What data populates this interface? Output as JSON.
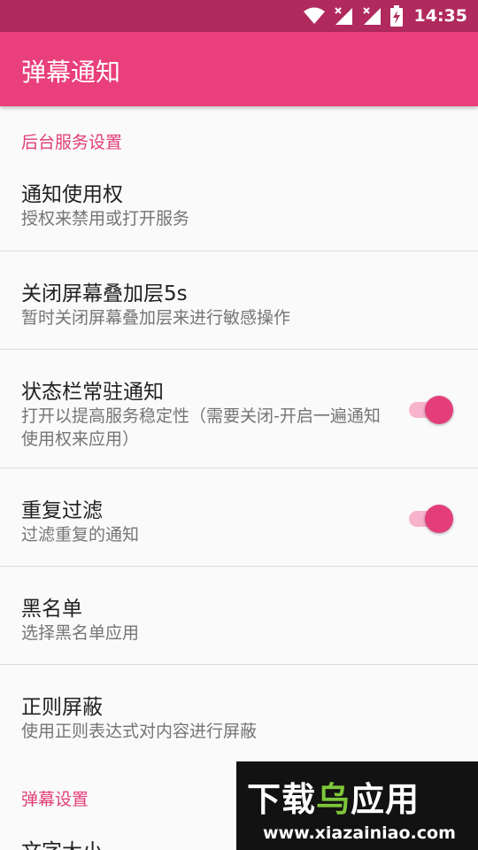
{
  "status_bar": {
    "time": "14:35",
    "icons": [
      "wifi-icon",
      "signal-icon",
      "signal-icon",
      "battery-charging-icon"
    ]
  },
  "app_bar": {
    "title": "弹幕通知"
  },
  "sections": [
    {
      "header": "后台服务设置",
      "items": [
        {
          "title": "通知使用权",
          "summary": "授权来禁用或打开服务"
        },
        {
          "title": "关闭屏幕叠加层5s",
          "summary": "暂时关闭屏幕叠加层来进行敏感操作"
        },
        {
          "title": "状态栏常驻通知",
          "summary": "打开以提高服务稳定性（需要关闭-开启一遍通知使用权来应用）",
          "switch_on": true
        },
        {
          "title": "重复过滤",
          "summary": "过滤重复的通知",
          "switch_on": true
        },
        {
          "title": "黑名单",
          "summary": "选择黑名单应用"
        },
        {
          "title": "正则屏蔽",
          "summary": "使用正则表达式对内容进行屏蔽"
        }
      ]
    },
    {
      "header": "弹幕设置",
      "items": [
        {
          "title": "文字大小"
        }
      ]
    }
  ],
  "watermark": {
    "logo_part1": "下载",
    "logo_part2": "乌",
    "logo_part3": "应用",
    "url": "www.xiazainiao.com"
  },
  "colors": {
    "status_bar": "#b02a5e",
    "app_bar": "#e93f7b",
    "accent": "#e43e7a",
    "switch_track": "#f6b3cb"
  }
}
